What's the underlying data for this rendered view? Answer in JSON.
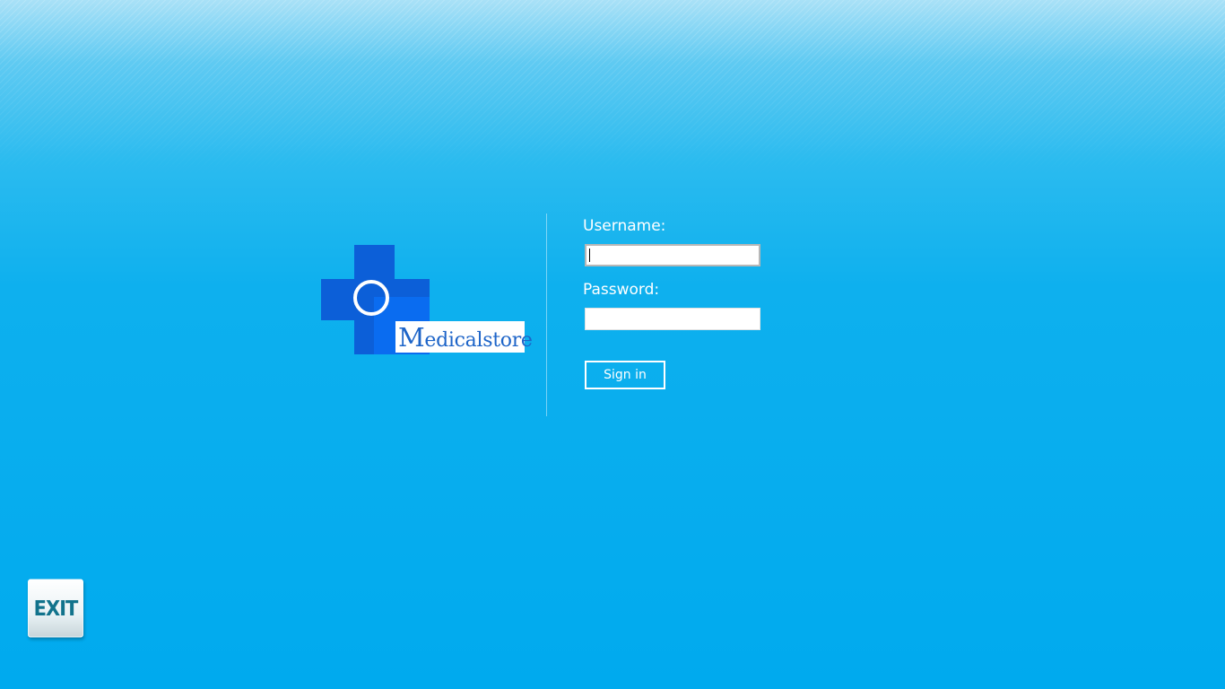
{
  "logo": {
    "name_first": "M",
    "name_rest": "edicalstore",
    "colors": {
      "cross": "#0c5fd8",
      "inner_square": "#0a6cf0",
      "label_text": "#1d64c8"
    }
  },
  "login_form": {
    "username_label": "Username:",
    "username_value": "",
    "password_label": "Password:",
    "password_value": "",
    "signin_label": "Sign in"
  },
  "exit_button": {
    "label": "EXIT",
    "text_color": "#12738c"
  },
  "background": {
    "color": "#00aaee"
  }
}
